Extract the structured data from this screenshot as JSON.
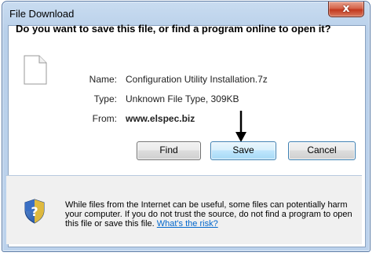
{
  "window": {
    "title": "File Download",
    "close_glyph": "x"
  },
  "dialog": {
    "question": "Do you want to save this file, or find a program online to open it?",
    "file": {
      "name_label": "Name:",
      "name_value": "Configuration Utility Installation.7z",
      "type_label": "Type:",
      "type_value": "Unknown File Type, 309KB",
      "from_label": "From:",
      "from_value": "www.elspec.biz"
    },
    "buttons": {
      "find": "Find",
      "save": "Save",
      "cancel": "Cancel"
    },
    "warning": {
      "text": "While files from the Internet can be useful, some files can potentially harm your computer. If you do not trust the source, do not find a program to open this file or save this file.",
      "link": "What's the risk?"
    }
  },
  "icons": {
    "file": "file-icon",
    "shield": "shield-question-icon",
    "arrow": "down-arrow-icon",
    "close": "close-icon"
  },
  "colors": {
    "link": "#0066cc",
    "titlebar": "#bcd2ec",
    "close_button": "#c2391f",
    "focused_button_border": "#3c7fb1"
  }
}
